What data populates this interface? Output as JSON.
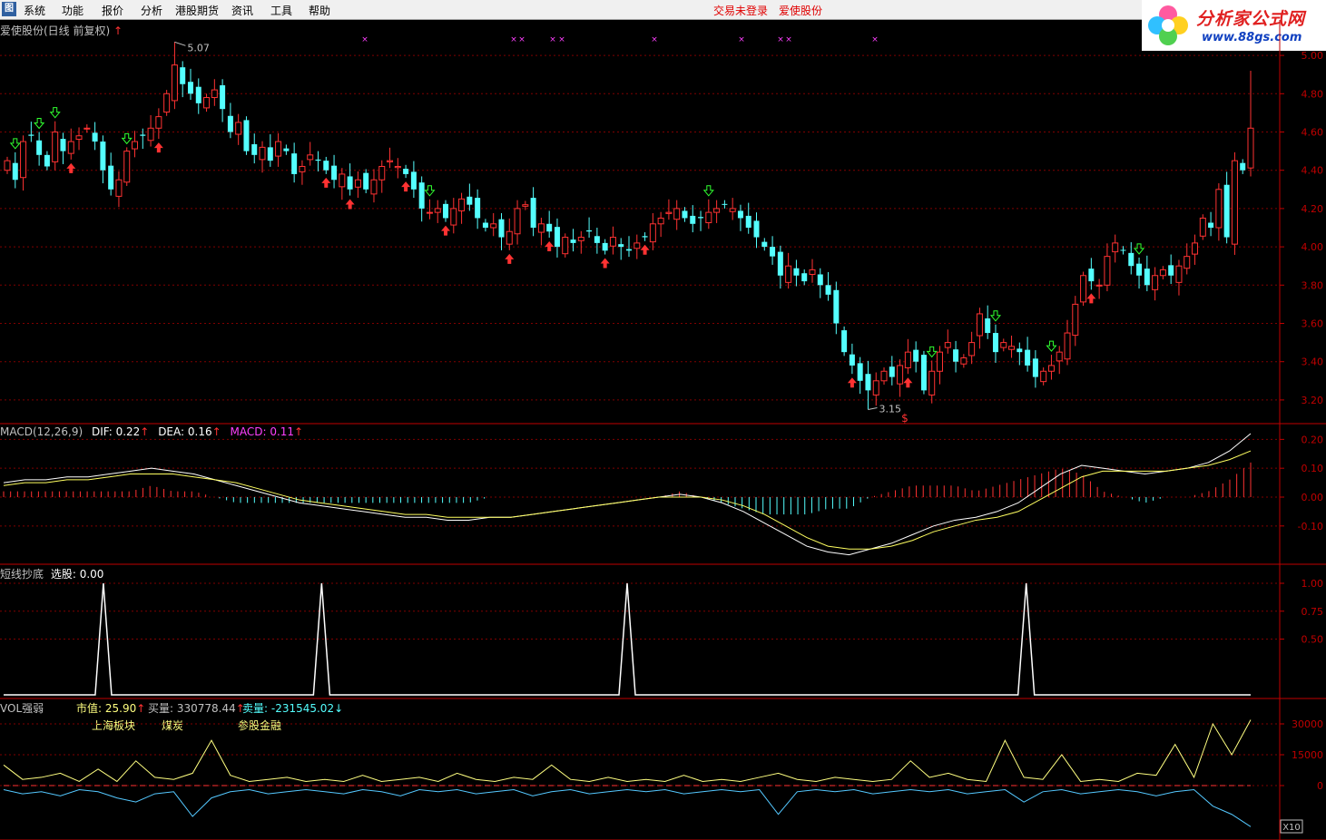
{
  "menu": {
    "logo": "图",
    "items": [
      "系统",
      "功能",
      "报价",
      "分析",
      "港股期货",
      "资讯",
      "工具",
      "帮助"
    ],
    "status_login": "交易未登录",
    "status_stock": "爱使股份"
  },
  "brand": {
    "name": "分析家公式网",
    "url": "www.88gs.com"
  },
  "colors": {
    "up": "#ff3232",
    "down": "#54ffff",
    "grid": "#800000",
    "axis": "#c00000"
  },
  "price_panel": {
    "title": "爱使股份(日线 前复权)",
    "title_arrow": "↑",
    "high_label": "5.07",
    "low_label": "3.15",
    "y_ticks": [
      "5.00",
      "4.80",
      "4.60",
      "4.40",
      "4.20",
      "4.00",
      "3.80",
      "3.60",
      "3.40",
      "3.20"
    ],
    "dollar_marker": "$",
    "price_range": [
      3.1,
      5.1
    ]
  },
  "macd_panel": {
    "name": "MACD(12,26,9)",
    "dif_label": "DIF: 0.22",
    "dea_label": "DEA: 0.16",
    "macd_label": "MACD: 0.11",
    "arrow": "↑",
    "y_ticks": [
      "0.20",
      "0.10",
      "0.00",
      "-0.10"
    ]
  },
  "signal_panel": {
    "title": "短线抄底",
    "value_label": "选股: 0.00",
    "y_ticks": [
      "1.00",
      "0.75",
      "0.50"
    ]
  },
  "vol_panel": {
    "title": "VOL强弱",
    "shizhi": "市值: 25.90",
    "buy": "买量: 330778.44",
    "sell": "卖量: -231545.02",
    "up_arrow": "↑",
    "down_arrow": "↓",
    "sector1": "上海板块",
    "sector2": "煤炭",
    "sector3": "参股金融",
    "y_ticks": [
      "30000",
      "15000",
      "0"
    ],
    "unit_label": "X10"
  },
  "chart_data": [
    {
      "type": "candlestick",
      "title": "爱使股份(日线 前复权)",
      "ylim": [
        3.1,
        5.1
      ],
      "close": [
        4.45,
        4.35,
        4.55,
        4.58,
        4.48,
        4.42,
        4.6,
        4.5,
        4.55,
        4.58,
        4.62,
        4.55,
        4.4,
        4.3,
        4.35,
        4.5,
        4.55,
        4.58,
        4.62,
        4.68,
        4.8,
        4.95,
        4.85,
        4.8,
        4.75,
        4.78,
        4.82,
        4.72,
        4.6,
        4.65,
        4.5,
        4.48,
        4.52,
        4.45,
        4.55,
        4.5,
        4.38,
        4.42,
        4.48,
        4.45,
        4.4,
        4.35,
        4.38,
        4.3,
        4.35,
        4.3,
        4.35,
        4.42,
        4.45,
        4.42,
        4.38,
        4.3,
        4.2,
        4.18,
        4.2,
        4.15,
        4.2,
        4.25,
        4.22,
        4.15,
        4.1,
        4.12,
        4.05,
        4.08,
        4.2,
        4.22,
        4.1,
        4.12,
        4.08,
        4.0,
        4.05,
        4.02,
        4.05,
        4.08,
        4.02,
        3.98,
        4.05,
        4.0,
        3.98,
        4.02,
        4.05,
        4.12,
        4.15,
        4.18,
        4.2,
        4.15,
        4.12,
        4.15,
        4.18,
        4.2,
        4.22,
        4.2,
        4.15,
        4.1,
        4.05,
        4.0,
        3.95,
        3.85,
        3.9,
        3.85,
        3.82,
        3.88,
        3.8,
        3.75,
        3.6,
        3.45,
        3.38,
        3.3,
        3.25,
        3.3,
        3.35,
        3.32,
        3.38,
        3.45,
        3.4,
        3.25,
        3.35,
        3.45,
        3.5,
        3.4,
        3.42,
        3.5,
        3.65,
        3.55,
        3.45,
        3.5,
        3.48,
        3.45,
        3.38,
        3.32,
        3.35,
        3.38,
        3.45,
        3.55,
        3.7,
        3.85,
        3.82,
        3.8,
        3.95,
        4.02,
        3.98,
        3.9,
        3.85,
        3.8,
        3.85,
        3.88,
        3.85,
        3.9,
        3.95,
        4.02,
        4.15,
        4.1,
        4.3,
        4.05,
        4.45,
        4.4,
        4.62
      ]
    },
    {
      "type": "line",
      "name": "MACD",
      "series": [
        {
          "name": "DIF",
          "values": [
            0.05,
            0.06,
            0.06,
            0.07,
            0.07,
            0.08,
            0.09,
            0.1,
            0.09,
            0.08,
            0.06,
            0.04,
            0.02,
            0.0,
            -0.02,
            -0.03,
            -0.04,
            -0.05,
            -0.06,
            -0.07,
            -0.07,
            -0.08,
            -0.08,
            -0.07,
            -0.07,
            -0.06,
            -0.05,
            -0.04,
            -0.03,
            -0.02,
            -0.01,
            0.0,
            0.01,
            0.0,
            -0.02,
            -0.05,
            -0.09,
            -0.13,
            -0.17,
            -0.19,
            -0.2,
            -0.18,
            -0.16,
            -0.13,
            -0.1,
            -0.08,
            -0.07,
            -0.05,
            -0.02,
            0.03,
            0.08,
            0.11,
            0.1,
            0.09,
            0.08,
            0.09,
            0.1,
            0.12,
            0.16,
            0.22
          ]
        },
        {
          "name": "DEA",
          "values": [
            0.04,
            0.05,
            0.05,
            0.06,
            0.06,
            0.07,
            0.08,
            0.08,
            0.08,
            0.07,
            0.06,
            0.05,
            0.03,
            0.01,
            -0.01,
            -0.02,
            -0.03,
            -0.04,
            -0.05,
            -0.06,
            -0.06,
            -0.07,
            -0.07,
            -0.07,
            -0.07,
            -0.06,
            -0.05,
            -0.04,
            -0.03,
            -0.02,
            -0.01,
            0.0,
            0.0,
            0.0,
            -0.01,
            -0.03,
            -0.06,
            -0.1,
            -0.14,
            -0.17,
            -0.18,
            -0.18,
            -0.17,
            -0.15,
            -0.12,
            -0.1,
            -0.08,
            -0.07,
            -0.05,
            -0.01,
            0.03,
            0.07,
            0.09,
            0.09,
            0.09,
            0.09,
            0.1,
            0.11,
            0.13,
            0.16
          ]
        }
      ],
      "ylim": [
        -0.22,
        0.22
      ]
    },
    {
      "type": "line",
      "name": "短线抄底",
      "spike_positions": [
        0.08,
        0.255,
        0.5,
        0.82
      ],
      "ylim": [
        0,
        1
      ]
    },
    {
      "type": "line",
      "name": "VOL强弱",
      "series": [
        {
          "name": "买量",
          "values": [
            10,
            3,
            4,
            6,
            2,
            8,
            2,
            12,
            4,
            3,
            6,
            22,
            5,
            2,
            3,
            4,
            2,
            3,
            2,
            5,
            2,
            3,
            4,
            2,
            6,
            3,
            2,
            4,
            3,
            10,
            3,
            2,
            4,
            2,
            3,
            2,
            5,
            2,
            3,
            2,
            4,
            6,
            3,
            2,
            4,
            3,
            2,
            3,
            12,
            4,
            6,
            3,
            2,
            22,
            4,
            3,
            15,
            2,
            3,
            2,
            6,
            5,
            20,
            4,
            30,
            15,
            32
          ]
        },
        {
          "name": "卖量",
          "values": [
            -2,
            -4,
            -3,
            -5,
            -2,
            -3,
            -6,
            -8,
            -4,
            -3,
            -15,
            -6,
            -3,
            -2,
            -4,
            -3,
            -2,
            -3,
            -4,
            -2,
            -3,
            -5,
            -2,
            -3,
            -2,
            -4,
            -3,
            -2,
            -5,
            -3,
            -2,
            -4,
            -3,
            -2,
            -3,
            -2,
            -4,
            -3,
            -2,
            -3,
            -2,
            -14,
            -3,
            -2,
            -3,
            -2,
            -4,
            -3,
            -2,
            -3,
            -2,
            -4,
            -3,
            -2,
            -8,
            -3,
            -2,
            -4,
            -3,
            -2,
            -3,
            -5,
            -3,
            -2,
            -10,
            -14,
            -20
          ]
        }
      ],
      "ylim": [
        -25,
        35
      ]
    }
  ]
}
